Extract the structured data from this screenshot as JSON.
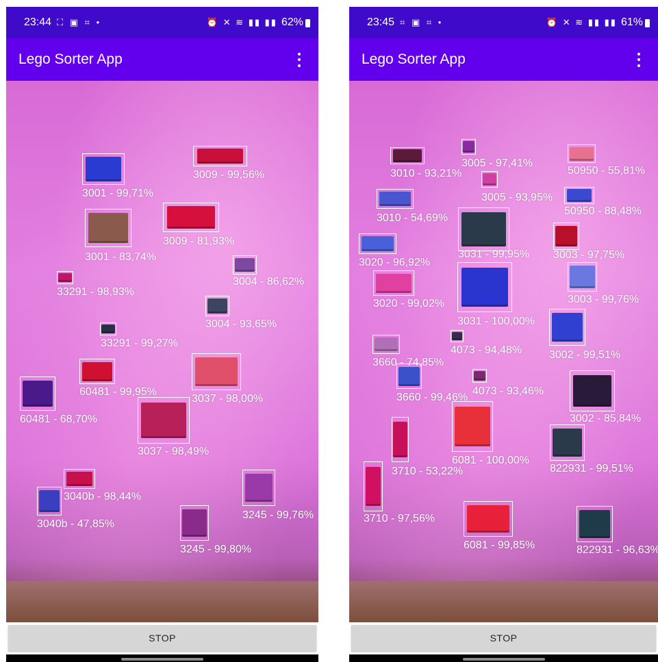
{
  "left": {
    "status": {
      "time": "23:44",
      "battery": "62%"
    },
    "app": {
      "title": "Lego Sorter App"
    },
    "stop_label": "STOP",
    "detections": [
      {
        "label": "3001 - 99,71%",
        "color": "#2a3bd1"
      },
      {
        "label": "3009 - 99,56%",
        "color": "#c8103a"
      },
      {
        "label": "3009 - 81,93%",
        "color": "#d5103c"
      },
      {
        "label": "3001 - 83,74%",
        "color": "#8a5a4c"
      },
      {
        "label": "3004 - 86,62%",
        "color": "#7b4aa0"
      },
      {
        "label": "33291 - 98,93%",
        "color": "#c0156a"
      },
      {
        "label": "3004 - 93,65%",
        "color": "#3c4560"
      },
      {
        "label": "33291 - 99,27%",
        "color": "#2a2f45"
      },
      {
        "label": "60481 - 99,95%",
        "color": "#d01030"
      },
      {
        "label": "3037 - 98,00%",
        "color": "#e0506a"
      },
      {
        "label": "60481 - 68,70%",
        "color": "#4b1a8a"
      },
      {
        "label": "3037 - 98,49%",
        "color": "#b8205a"
      },
      {
        "label": "3040b - 98,44%",
        "color": "#c8104a"
      },
      {
        "label": "3040b - 47,85%",
        "color": "#3a3fc0"
      },
      {
        "label": "3245 - 99,76%",
        "color": "#9a3aa8"
      },
      {
        "label": "3245 - 99,80%",
        "color": "#8a2a8a"
      }
    ]
  },
  "right": {
    "status": {
      "time": "23:45",
      "battery": "61%"
    },
    "app": {
      "title": "Lego Sorter App"
    },
    "stop_label": "STOP",
    "detections": [
      {
        "label": "3010 - 93,21%",
        "color": "#5a1a3a"
      },
      {
        "label": "3005 - 97,41%",
        "color": "#8a2aa0"
      },
      {
        "label": "50950 - 55,81%",
        "color": "#e87090"
      },
      {
        "label": "3005 - 93,95%",
        "color": "#d040a0"
      },
      {
        "label": "50950 - 88,48%",
        "color": "#3a4ad0"
      },
      {
        "label": "3010 - 54,69%",
        "color": "#4a55d0"
      },
      {
        "label": "3031 - 99,95%",
        "color": "#2a3a4a"
      },
      {
        "label": "3003 - 97,75%",
        "color": "#b8102a"
      },
      {
        "label": "3020 - 96,92%",
        "color": "#4a60d8"
      },
      {
        "label": "3020 - 99,02%",
        "color": "#e040a0"
      },
      {
        "label": "3031 - 100,00%",
        "color": "#2a35d0"
      },
      {
        "label": "3003 - 99,76%",
        "color": "#6a78e0"
      },
      {
        "label": "4073 - 94,48%",
        "color": "#3a2a50"
      },
      {
        "label": "3002 - 99,51%",
        "color": "#3040d0"
      },
      {
        "label": "3660 - 74,85%",
        "color": "#b070b8"
      },
      {
        "label": "3660 - 99,46%",
        "color": "#3a50c8"
      },
      {
        "label": "4073 - 93,46%",
        "color": "#7a2a70"
      },
      {
        "label": "3002 - 85,84%",
        "color": "#2a1a3a"
      },
      {
        "label": "6081 - 100,00%",
        "color": "#e8303a"
      },
      {
        "label": "3710 - 53,22%",
        "color": "#c8105a"
      },
      {
        "label": "822931 - 99,51%",
        "color": "#2a3a4a"
      },
      {
        "label": "3710 - 97,56%",
        "color": "#d01060"
      },
      {
        "label": "6081 - 99,85%",
        "color": "#e8203a"
      },
      {
        "label": "822931 - 96,63%",
        "color": "#1f3a48"
      }
    ]
  }
}
